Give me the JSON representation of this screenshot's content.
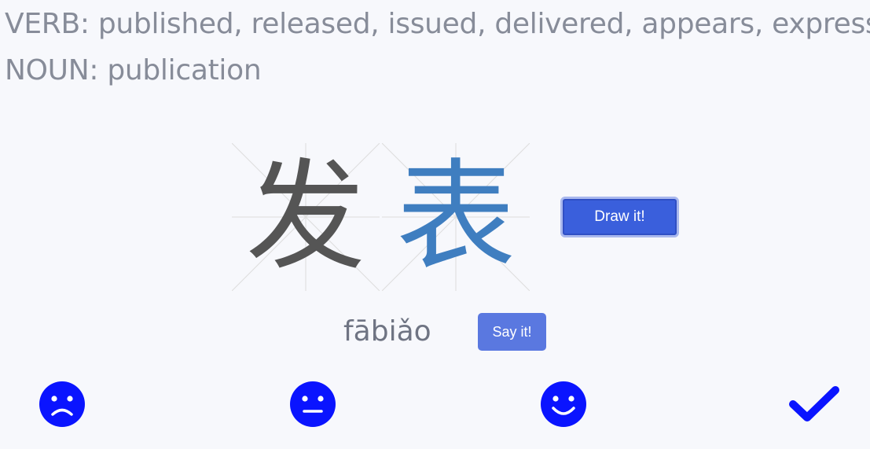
{
  "definitions": {
    "verb": "VERB: published, released, issued, delivered, appears, express",
    "noun": "NOUN: publication"
  },
  "characters": [
    {
      "char": "发"
    },
    {
      "char": "表"
    }
  ],
  "buttons": {
    "draw": "Draw it!",
    "say": "Say it!"
  },
  "pinyin": "fābiǎo",
  "rating": {
    "icons": [
      "sad-face-icon",
      "neutral-face-icon",
      "happy-face-icon",
      "checkmark-icon"
    ],
    "icon_color": "#0a14ff"
  },
  "colors": {
    "draw_button": "#3a5fdc",
    "say_button": "#5a78e0",
    "stroke_done": "#555555",
    "stroke_active": "#3f7ec0"
  }
}
